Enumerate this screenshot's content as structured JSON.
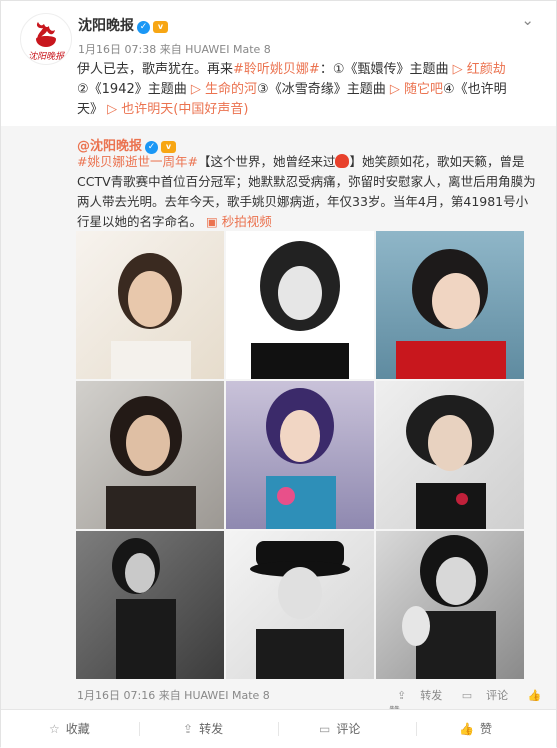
{
  "header": {
    "account_name": "沈阳晚报",
    "timestamp": "1月16日 07:38 来自 HUAWEI Mate 8",
    "menu_icon": "chevron-down-icon"
  },
  "post": {
    "line1_text": "伊人已去，歌声犹在。再来",
    "line1_topic": "#聆听姚贝娜#",
    "line1_item1": "：①《甄嬛传》主题曲",
    "line1_link1": "红颜劫",
    "line2_item2": "②《1942》主题曲",
    "line2_link2": "生命的河",
    "line2_item3": "③《冰雪奇缘》主题曲",
    "line2_link3": "随它吧",
    "line2_item4": "④《也许明",
    "line3_item4_rest": "天》",
    "line3_link4": "也许明天(中国好声音)"
  },
  "repost": {
    "author": "@沈阳晚报",
    "topic": "#姚贝娜逝世一周年#",
    "text_a": "【这个世界，她曾经来过",
    "text_b": "】她笑颜如花，歌如天籁，曾是CCTV青歌赛中首位百分冠军；她默默忍受病痛，弥留时安慰家人，离世后用角膜为两人带去光明。去年今天，歌手姚贝娜病逝，年仅33岁。当年4月，第41981号小行星以她的名字命名。",
    "video_link": "秒拍视频",
    "timestamp": "1月16日 07:16 来自 HUAWEI Mate 8",
    "actions": {
      "forward": "转发",
      "comment": "评论",
      "like": "赞"
    }
  },
  "bottom_bar": {
    "favorite": "收藏",
    "forward": "转发",
    "comment": "评论",
    "like": "赞"
  },
  "colors": {
    "accent": "#eb7350",
    "verified": "#1a97f5"
  }
}
